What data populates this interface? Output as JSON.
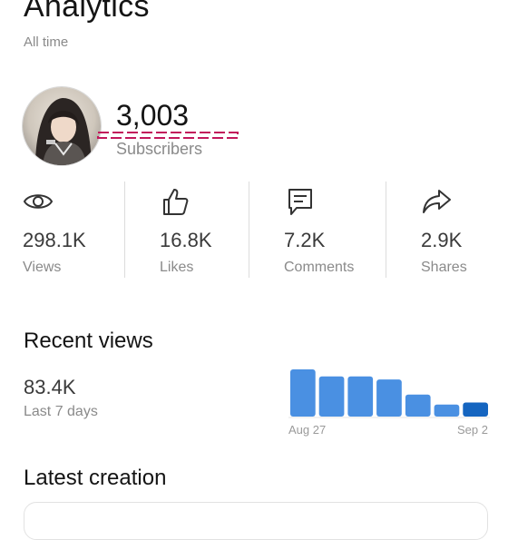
{
  "header": {
    "title": "Analytics",
    "subtitle": "All time"
  },
  "profile": {
    "subscriber_count": "3,003",
    "subscriber_label": "Subscribers"
  },
  "stats": [
    {
      "icon": "eye-icon",
      "value": "298.1K",
      "label": "Views"
    },
    {
      "icon": "thumbs-up-icon",
      "value": "16.8K",
      "label": "Likes"
    },
    {
      "icon": "comment-icon",
      "value": "7.2K",
      "label": "Comments"
    },
    {
      "icon": "share-arrow-icon",
      "value": "2.9K",
      "label": "Shares"
    }
  ],
  "recent_views": {
    "title": "Recent views",
    "value": "83.4K",
    "period_label": "Last 7 days"
  },
  "latest_creation": {
    "title": "Latest creation"
  },
  "colors": {
    "bar": "#4a90e2",
    "bar_last": "#1565c0",
    "underline": "#c2185b"
  },
  "chart_data": {
    "type": "bar",
    "categories": [
      "",
      "",
      "",
      "",
      "",
      "",
      ""
    ],
    "values": [
      47,
      40,
      40,
      37,
      22,
      12,
      14
    ],
    "x_tick_labels": [
      "Aug 27",
      "Sep 2"
    ],
    "title": "",
    "xlabel": "",
    "ylabel": "",
    "grid": false
  }
}
